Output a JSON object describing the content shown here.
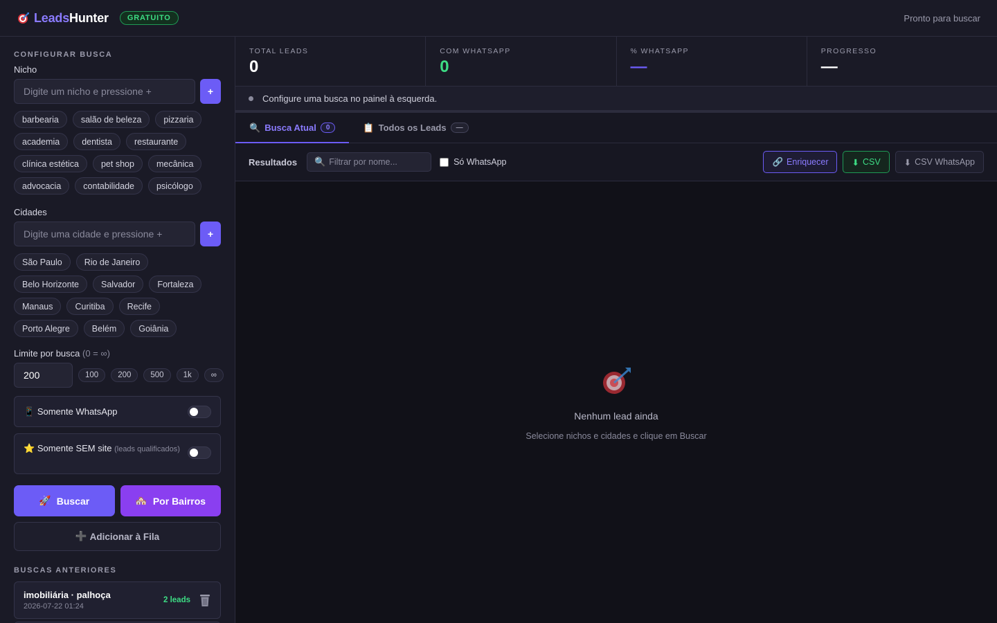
{
  "header": {
    "logo_leads": "Leads",
    "logo_hunter": "Hunter",
    "badge": "GRATUITO",
    "status": "Pronto para buscar"
  },
  "sidebar": {
    "section_title": "CONFIGURAR BUSCA",
    "nicho_label": "Nicho",
    "nicho_placeholder": "Digite um nicho e pressione +",
    "nicho_chips": [
      "barbearia",
      "salão de beleza",
      "pizzaria",
      "academia",
      "dentista",
      "restaurante",
      "clínica estética",
      "pet shop",
      "mecânica",
      "advocacia",
      "contabilidade",
      "psicólogo"
    ],
    "cidades_label": "Cidades",
    "cidades_placeholder": "Digite uma cidade e pressione +",
    "cidade_chips": [
      "São Paulo",
      "Rio de Janeiro",
      "Belo Horizonte",
      "Salvador",
      "Fortaleza",
      "Manaus",
      "Curitiba",
      "Recife",
      "Porto Alegre",
      "Belém",
      "Goiânia"
    ],
    "plus_label": "+",
    "limit_label": "Limite por busca",
    "limit_hint": "(0 = ∞)",
    "limit_value": "200",
    "limit_presets": [
      "100",
      "200",
      "500",
      "1k",
      "∞"
    ],
    "toggle_whatsapp": "Somente WhatsApp",
    "toggle_whatsapp_on": false,
    "toggle_sem_site": "Somente SEM site",
    "toggle_sem_site_hint": "(leads qualificados)",
    "toggle_sem_site_on": false,
    "btn_buscar": "Buscar",
    "btn_bairros": "Por Bairros",
    "btn_fila": "Adicionar à Fila",
    "history_title": "BUSCAS ANTERIORES",
    "history": [
      {
        "title": "imobiliária · palhoça",
        "date": "2026-07-22 01:24",
        "leads": "2 leads"
      }
    ]
  },
  "stats": [
    {
      "label": "TOTAL LEADS",
      "value": "0",
      "color": "#ffffff"
    },
    {
      "label": "COM WHATSAPP",
      "value": "0",
      "color": "#3ddc84"
    },
    {
      "label": "% WHATSAPP",
      "value": "—",
      "color": "#6c5cf6"
    },
    {
      "label": "PROGRESSO",
      "value": "—",
      "color": "#ffffff"
    }
  ],
  "info_message": "Configure uma busca no painel à esquerda.",
  "tabs": [
    {
      "label": "Busca Atual",
      "count": "0",
      "icon": "magnifier-icon"
    },
    {
      "label": "Todos os Leads",
      "count": "—",
      "icon": "clipboard-icon"
    }
  ],
  "toolbar": {
    "title": "Resultados",
    "filter_placeholder": "Filtrar por nome...",
    "checkbox_label": "Só WhatsApp",
    "btn_enrich": "Enriquecer",
    "btn_csv": "CSV",
    "btn_csv_whatsapp": "CSV WhatsApp"
  },
  "empty": {
    "title": "Nenhum lead ainda",
    "subtitle": "Selecione nichos e cidades e clique em Buscar"
  },
  "colors": {
    "accent": "#6c5cf6",
    "green": "#3ddc84",
    "purple_btn": "#8a3ff0"
  }
}
